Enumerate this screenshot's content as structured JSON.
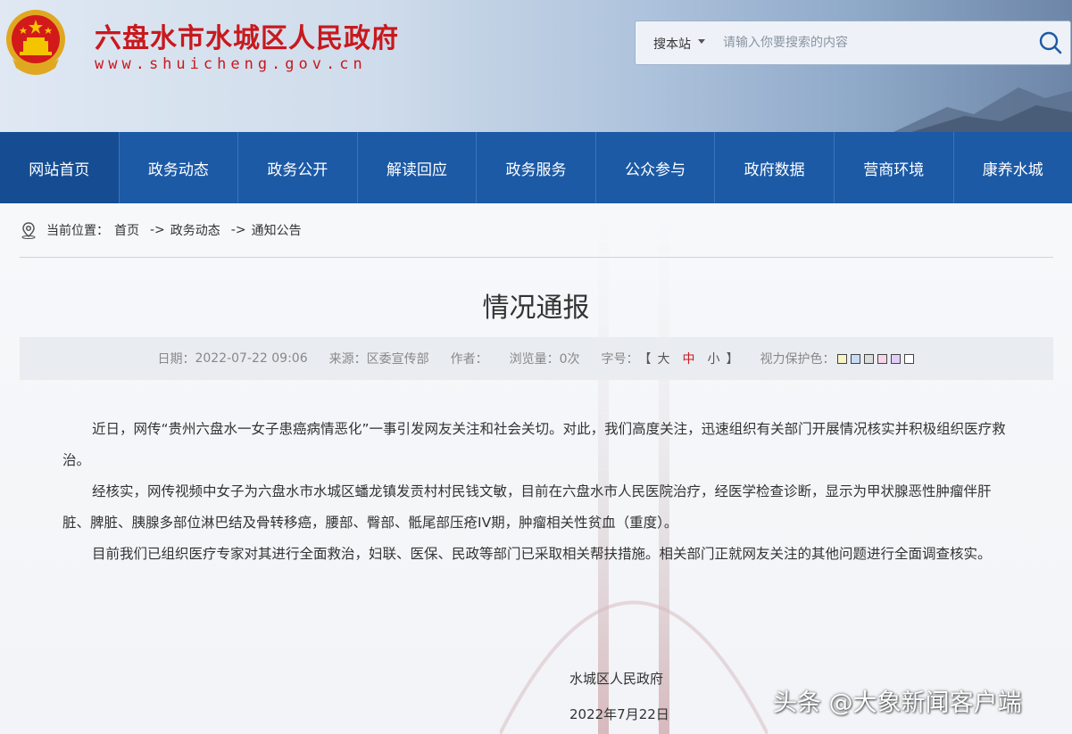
{
  "header": {
    "title": "六盘水市水城区人民政府",
    "url": "www.shuicheng.gov.cn",
    "search": {
      "scope_label": "搜本站",
      "placeholder": "请输入你要搜索的内容"
    }
  },
  "nav": {
    "items": [
      "网站首页",
      "政务动态",
      "政务公开",
      "解读回应",
      "政务服务",
      "公众参与",
      "政府数据",
      "营商环境",
      "康养水城"
    ]
  },
  "breadcrumb": {
    "prefix": "当前位置：",
    "items": [
      "首页",
      "政务动态",
      "通知公告"
    ],
    "separator": "->"
  },
  "article": {
    "title": "情况通报",
    "meta": {
      "date_label": "日期：",
      "date": "2022-07-22 09:06",
      "source_label": "来源：",
      "source": "区委宣传部",
      "author_label": "作者：",
      "views_label": "浏览量：",
      "views": "0次",
      "fontsize_label": "字号：",
      "fontsize_open": "【",
      "fontsize_large": "大",
      "fontsize_mid": "中",
      "fontsize_small": "小",
      "fontsize_close": "】",
      "eyecare_label": "视力保护色：",
      "eyecare_colors": [
        "#f7f3c4",
        "#c8dcf5",
        "#dcdcdc",
        "#f5d6e8",
        "#e2cdf7",
        "#ffffff"
      ]
    },
    "paragraphs": [
      "近日，网传“贵州六盘水一女子患癌病情恶化”一事引发网友关注和社会关切。对此，我们高度关注，迅速组织有关部门开展情况核实并积极组织医疗救治。",
      "经核实，网传视频中女子为六盘水市水城区蟠龙镇发贡村村民钱文敏，目前在六盘水市人民医院治疗，经医学检查诊断，显示为甲状腺恶性肿瘤伴肝脏、脾脏、胰腺多部位淋巴结及骨转移癌，腰部、臀部、骶尾部压疮IV期，肿瘤相关性贫血（重度）。",
      "目前我们已组织医疗专家对其进行全面救治，妇联、医保、民政等部门已采取相关帮扶措施。相关部门正就网友关注的其他问题进行全面调查核实。"
    ],
    "signature": "水城区人民政府",
    "sign_date": "2022年7月22日"
  },
  "watermark": "头条 @大象新闻客户端",
  "colors": {
    "brand_red": "#c8191d",
    "nav_blue": "#1c5aa6"
  }
}
